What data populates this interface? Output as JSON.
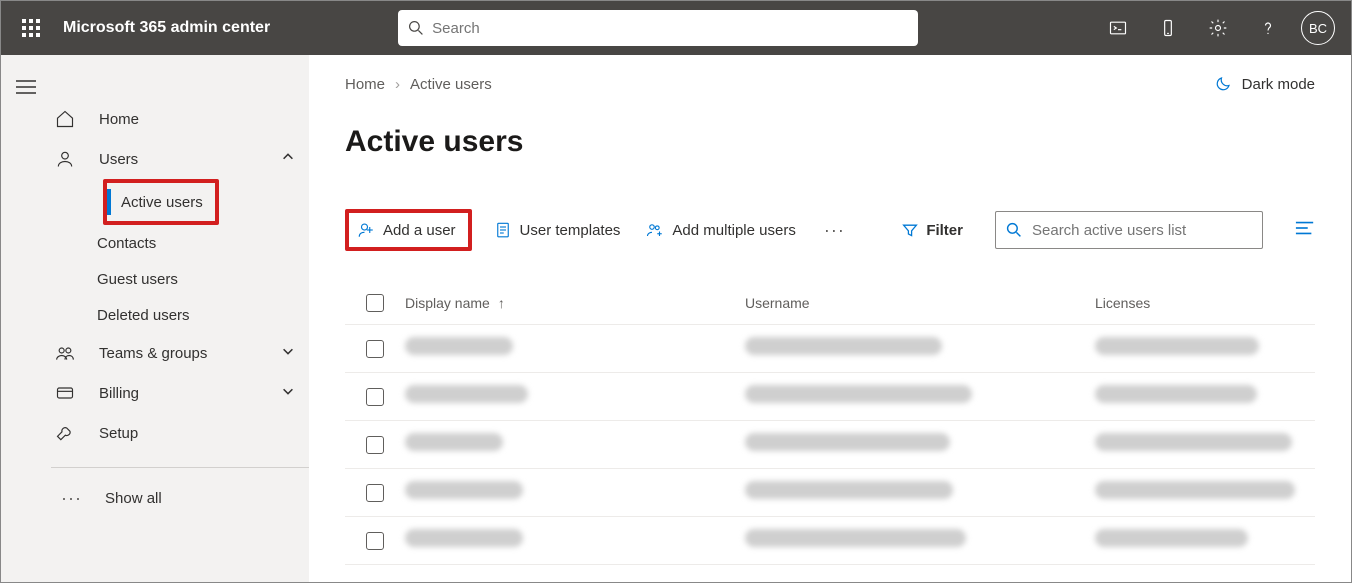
{
  "header": {
    "app_title": "Microsoft 365 admin center",
    "search_placeholder": "Search",
    "avatar_initials": "BC"
  },
  "sidebar": {
    "items": [
      {
        "label": "Home"
      },
      {
        "label": "Users",
        "expanded": true
      },
      {
        "label": "Teams & groups",
        "expanded": false
      },
      {
        "label": "Billing",
        "expanded": false
      },
      {
        "label": "Setup"
      }
    ],
    "users_sub": [
      {
        "label": "Active users",
        "active": true,
        "highlighted": true
      },
      {
        "label": "Contacts"
      },
      {
        "label": "Guest users"
      },
      {
        "label": "Deleted users"
      }
    ],
    "show_all_label": "Show all"
  },
  "breadcrumb": {
    "home": "Home",
    "current": "Active users"
  },
  "darkmode_label": "Dark mode",
  "page_title": "Active users",
  "commands": {
    "add_user": "Add a user",
    "user_templates": "User templates",
    "add_multiple": "Add multiple users",
    "filter": "Filter",
    "list_search_placeholder": "Search active users list"
  },
  "table": {
    "columns": {
      "display_name": "Display name",
      "username": "Username",
      "licenses": "Licenses"
    },
    "rows": [
      {
        "display_name": "▓▓▓▓▓▓",
        "username": "▓▓▓▓▓▓▓▓▓▓▓▓▓▓▓▓▓▓",
        "licenses": "▓▓▓▓▓▓▓▓▓▓▓▓▓▓"
      },
      {
        "display_name": "▓▓▓▓▓▓▓▓▓",
        "username": "▓▓▓▓▓▓▓▓▓▓▓▓▓▓▓▓▓▓▓▓",
        "licenses": "▓▓▓▓▓▓▓▓▓▓▓▓▓▓"
      },
      {
        "display_name": "▓▓▓▓▓▓▓",
        "username": "▓▓▓▓▓▓▓▓▓▓▓▓▓▓▓▓▓▓",
        "licenses": "▓▓▓▓▓▓▓▓▓▓▓▓▓▓▓▓▓▓"
      },
      {
        "display_name": "▓▓▓▓▓▓▓",
        "username": "▓▓▓▓▓▓▓▓▓▓▓▓▓▓▓▓▓▓",
        "licenses": "▓▓▓▓▓▓▓▓▓▓▓▓▓▓"
      },
      {
        "display_name": "▓▓▓▓▓▓▓",
        "username": "▓▓▓▓▓▓▓▓▓▓▓▓▓▓▓▓▓▓",
        "licenses": "▓▓▓▓▓▓▓▓▓▓▓▓▓▓"
      }
    ]
  }
}
